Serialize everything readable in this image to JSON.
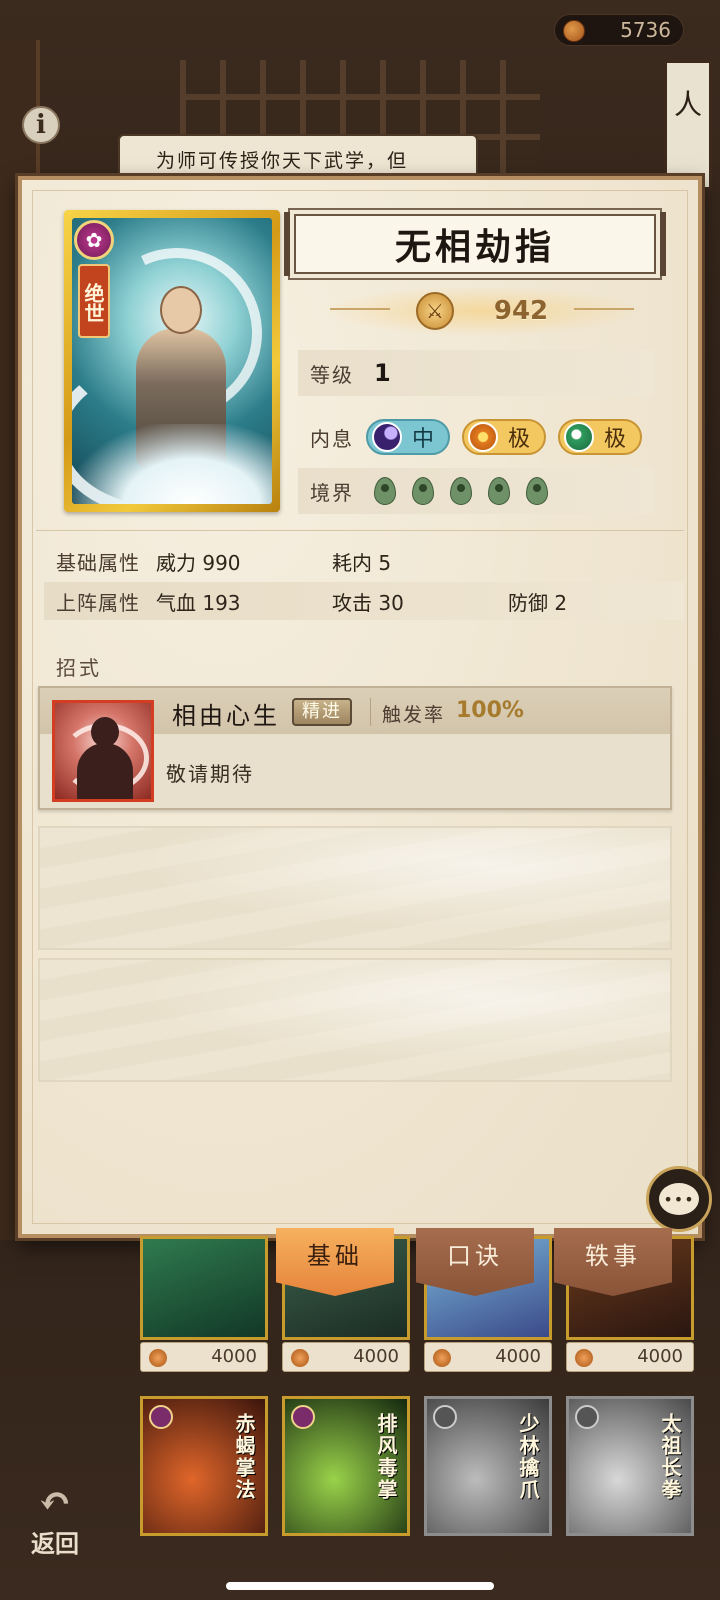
{
  "header": {
    "coin_amount": "5736"
  },
  "background": {
    "scroll_text": "人",
    "speech_text": "为师可传授你天下武学，但"
  },
  "skill": {
    "name": "无相劫指",
    "rarity_tag": "绝世",
    "power": "942",
    "level_label": "等级",
    "level_value": "1",
    "neixi_label": "内息",
    "neixi": [
      {
        "label": "中",
        "icon": "moon-orb-icon"
      },
      {
        "label": "极",
        "icon": "sun-orb-icon"
      },
      {
        "label": "极",
        "icon": "jade-orb-icon"
      }
    ],
    "realm_label": "境界",
    "realm_count": 5
  },
  "stats": {
    "base_label": "基础属性",
    "base_power": "威力 990",
    "base_cost": "耗内 5",
    "deploy_label": "上阵属性",
    "deploy_hp": "气血 193",
    "deploy_atk": "攻击 30",
    "deploy_def": "防御 2"
  },
  "moves": {
    "section_title": "招式",
    "items": [
      {
        "name": "相由心生",
        "badge": "精进",
        "rate_label": "触发率",
        "rate_value": "100%",
        "desc": "敬请期待"
      }
    ]
  },
  "tabs": {
    "basic": "基础",
    "mnemonic": "口诀",
    "anecdote": "轶事"
  },
  "grid": {
    "prices": [
      "4000",
      "4000",
      "4000",
      "4000"
    ],
    "cards": [
      {
        "name": "赤蝎掌法",
        "style": "red"
      },
      {
        "name": "排风毒掌",
        "style": "green"
      },
      {
        "name": "少林擒爪",
        "style": "gray"
      },
      {
        "name": "太祖长拳",
        "style": "gray"
      }
    ]
  },
  "nav": {
    "back_label": "返回"
  },
  "colors": {
    "accent": "#e6843c",
    "gold": "#d49a17",
    "panel": "#f1e8d6"
  }
}
